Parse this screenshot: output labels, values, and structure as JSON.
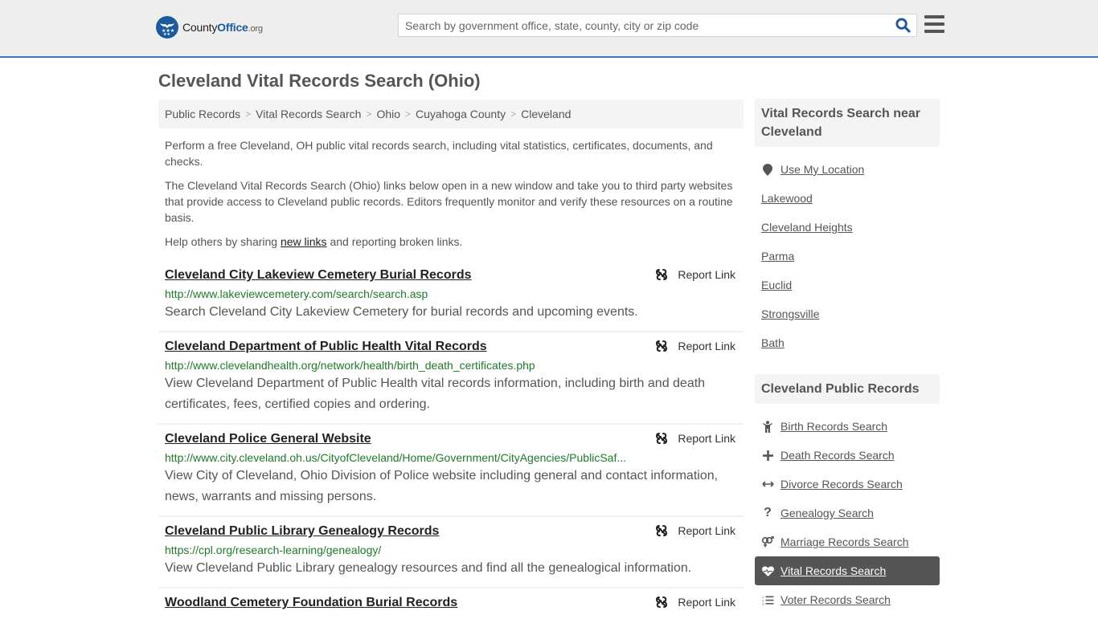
{
  "header": {
    "logo": {
      "county": "County",
      "office": "Office",
      "org": ".org"
    },
    "search_placeholder": "Search by government office, state, county, city or zip code",
    "search_value": "",
    "colors": {
      "brand": "#1c5a9e",
      "accent_border": "#3c7ab8"
    }
  },
  "page": {
    "title": "Cleveland Vital Records Search (Ohio)"
  },
  "breadcrumb": [
    {
      "label": "Public Records"
    },
    {
      "label": "Vital Records Search"
    },
    {
      "label": "Ohio"
    },
    {
      "label": "Cuyahoga County"
    },
    {
      "label": "Cleveland"
    }
  ],
  "intro": {
    "p1": "Perform a free Cleveland, OH public vital records search, including vital statistics, certificates, documents, and checks.",
    "p2": "The Cleveland Vital Records Search (Ohio) links below open in a new window and take you to third party websites that provide access to Cleveland public records. Editors frequently monitor and verify these resources on a routine basis.",
    "p3_before": "Help others by sharing ",
    "p3_link": "new links",
    "p3_after": " and reporting broken links."
  },
  "results": [
    {
      "title": "Cleveland City Lakeview Cemetery Burial Records",
      "url": "http://www.lakeviewcemetery.com/search/search.asp",
      "desc": "Search Cleveland City Lakeview Cemetery for burial records and upcoming events.",
      "report_label": "Report Link"
    },
    {
      "title": "Cleveland Department of Public Health Vital Records",
      "url": "http://www.clevelandhealth.org/network/health/birth_death_certificates.php",
      "desc": "View Cleveland Department of Public Health vital records information, including birth and death certificates, fees, certified copies and ordering.",
      "report_label": "Report Link"
    },
    {
      "title": "Cleveland Police General Website",
      "url": "http://www.city.cleveland.oh.us/CityofCleveland/Home/Government/CityAgencies/PublicSaf...",
      "desc": "View City of Cleveland, Ohio Division of Police website including general and contact information, news, warrants and missing persons.",
      "report_label": "Report Link"
    },
    {
      "title": "Cleveland Public Library Genealogy Records",
      "url": "https://cpl.org/research-learning/genealogy/",
      "desc": "View Cleveland Public Library genealogy resources and find all the genealogical information.",
      "report_label": "Report Link"
    },
    {
      "title": "Woodland Cemetery Foundation Burial Records",
      "url": "",
      "desc": "",
      "report_label": "Report Link"
    }
  ],
  "sidebar": {
    "nearby_title": "Vital Records Search near Cleveland",
    "use_location": {
      "label": "Use My Location",
      "icon": "map-marker-icon"
    },
    "nearby": [
      {
        "label": "Lakewood"
      },
      {
        "label": "Cleveland Heights"
      },
      {
        "label": "Parma"
      },
      {
        "label": "Euclid"
      },
      {
        "label": "Strongsville"
      },
      {
        "label": "Bath"
      }
    ],
    "public_title": "Cleveland Public Records",
    "public_records": [
      {
        "label": "Birth Records Search",
        "icon": "child-icon"
      },
      {
        "label": "Death Records Search",
        "icon": "plus-icon"
      },
      {
        "label": "Divorce Records Search",
        "icon": "arrows-horizontal-icon"
      },
      {
        "label": "Genealogy Search",
        "icon": "question-icon"
      },
      {
        "label": "Marriage Records Search",
        "icon": "venus-mars-icon"
      },
      {
        "label": "Vital Records Search",
        "icon": "heartbeat-icon",
        "active": true
      },
      {
        "label": "Voter Records Search",
        "icon": "list-ol-icon"
      }
    ]
  }
}
